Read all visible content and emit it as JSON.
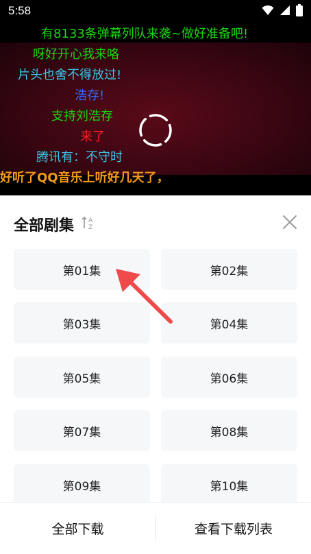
{
  "status_bar": {
    "time": "5:58"
  },
  "danmaku": [
    {
      "text": "有8133条弹幕列队来袭~做好准备吧!",
      "color": "#1ad60f"
    },
    {
      "text": "呀好开心我来咯",
      "color": "#1ad60f"
    },
    {
      "text": "片头也舍不得放过!",
      "color": "#38c8e8"
    },
    {
      "text": "浩存!",
      "color": "#3b6bff"
    },
    {
      "text": "支持刘浩存",
      "color": "#1ad60f"
    },
    {
      "text": "来了",
      "color": "#ff2020"
    },
    {
      "text": "腾讯有：不守时",
      "color": "#38c8e8"
    },
    {
      "text": "好听了QQ音乐上听好几天了，",
      "color": "#f39a1a"
    }
  ],
  "sheet": {
    "title": "全部剧集",
    "sort_icon": "sort-az-icon",
    "close_icon": "close-icon"
  },
  "episodes": [
    "第01集",
    "第02集",
    "第03集",
    "第04集",
    "第05集",
    "第06集",
    "第07集",
    "第08集",
    "第09集",
    "第10集"
  ],
  "footer": {
    "download_all": "全部下载",
    "view_downloads": "查看下载列表"
  },
  "colors": {
    "arrow": "#ee4a4a",
    "tile_bg": "#f6f7f9"
  }
}
